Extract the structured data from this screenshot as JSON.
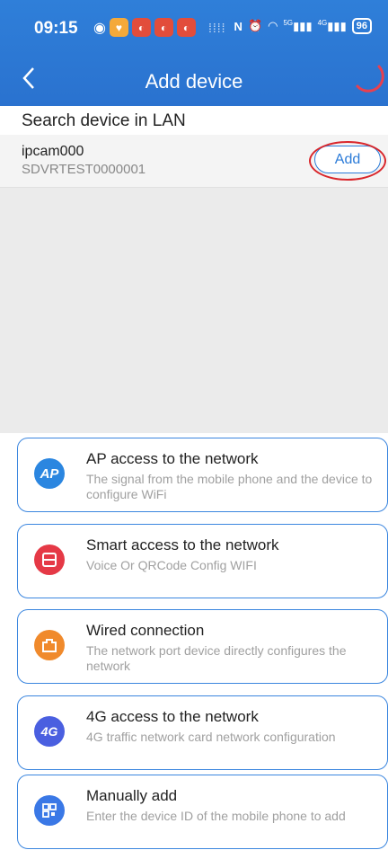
{
  "status_bar": {
    "time": "09:15",
    "signal_5g": "5G",
    "signal_4g": "4G",
    "battery": "96"
  },
  "nav": {
    "back_glyph": "<",
    "title": "Add device"
  },
  "section": {
    "title": "Search device in LAN"
  },
  "devices": [
    {
      "name": "ipcam000",
      "serial": "SDVRTEST0000001",
      "button": "Add"
    }
  ],
  "options": [
    {
      "title": "AP access to the network",
      "desc": "The signal from the mobile phone and the device to configure WiFi",
      "icon": "ap-icon",
      "icon_text": "AP",
      "color": "#2b86e0"
    },
    {
      "title": "Smart access to the network",
      "desc": "Voice Or QRCode Config WIFI",
      "icon": "smart-config-icon",
      "icon_text": "",
      "color": "#e53946"
    },
    {
      "title": "Wired connection",
      "desc": "The network port device directly configures the network",
      "icon": "ethernet-icon",
      "icon_text": "",
      "color": "#f08a2c"
    },
    {
      "title": "4G access to the network",
      "desc": "4G traffic network card network configuration",
      "icon": "4g-icon",
      "icon_text": "4G",
      "color": "#4a5fe0"
    },
    {
      "title": "Manually add",
      "desc": "Enter the device ID of the mobile phone to add",
      "icon": "qrcode-icon",
      "icon_text": "",
      "color": "#3a78e6"
    }
  ],
  "colors": {
    "header": "#2a72cf",
    "accent": "#2b7bd8",
    "annotation": "#d9262b"
  }
}
